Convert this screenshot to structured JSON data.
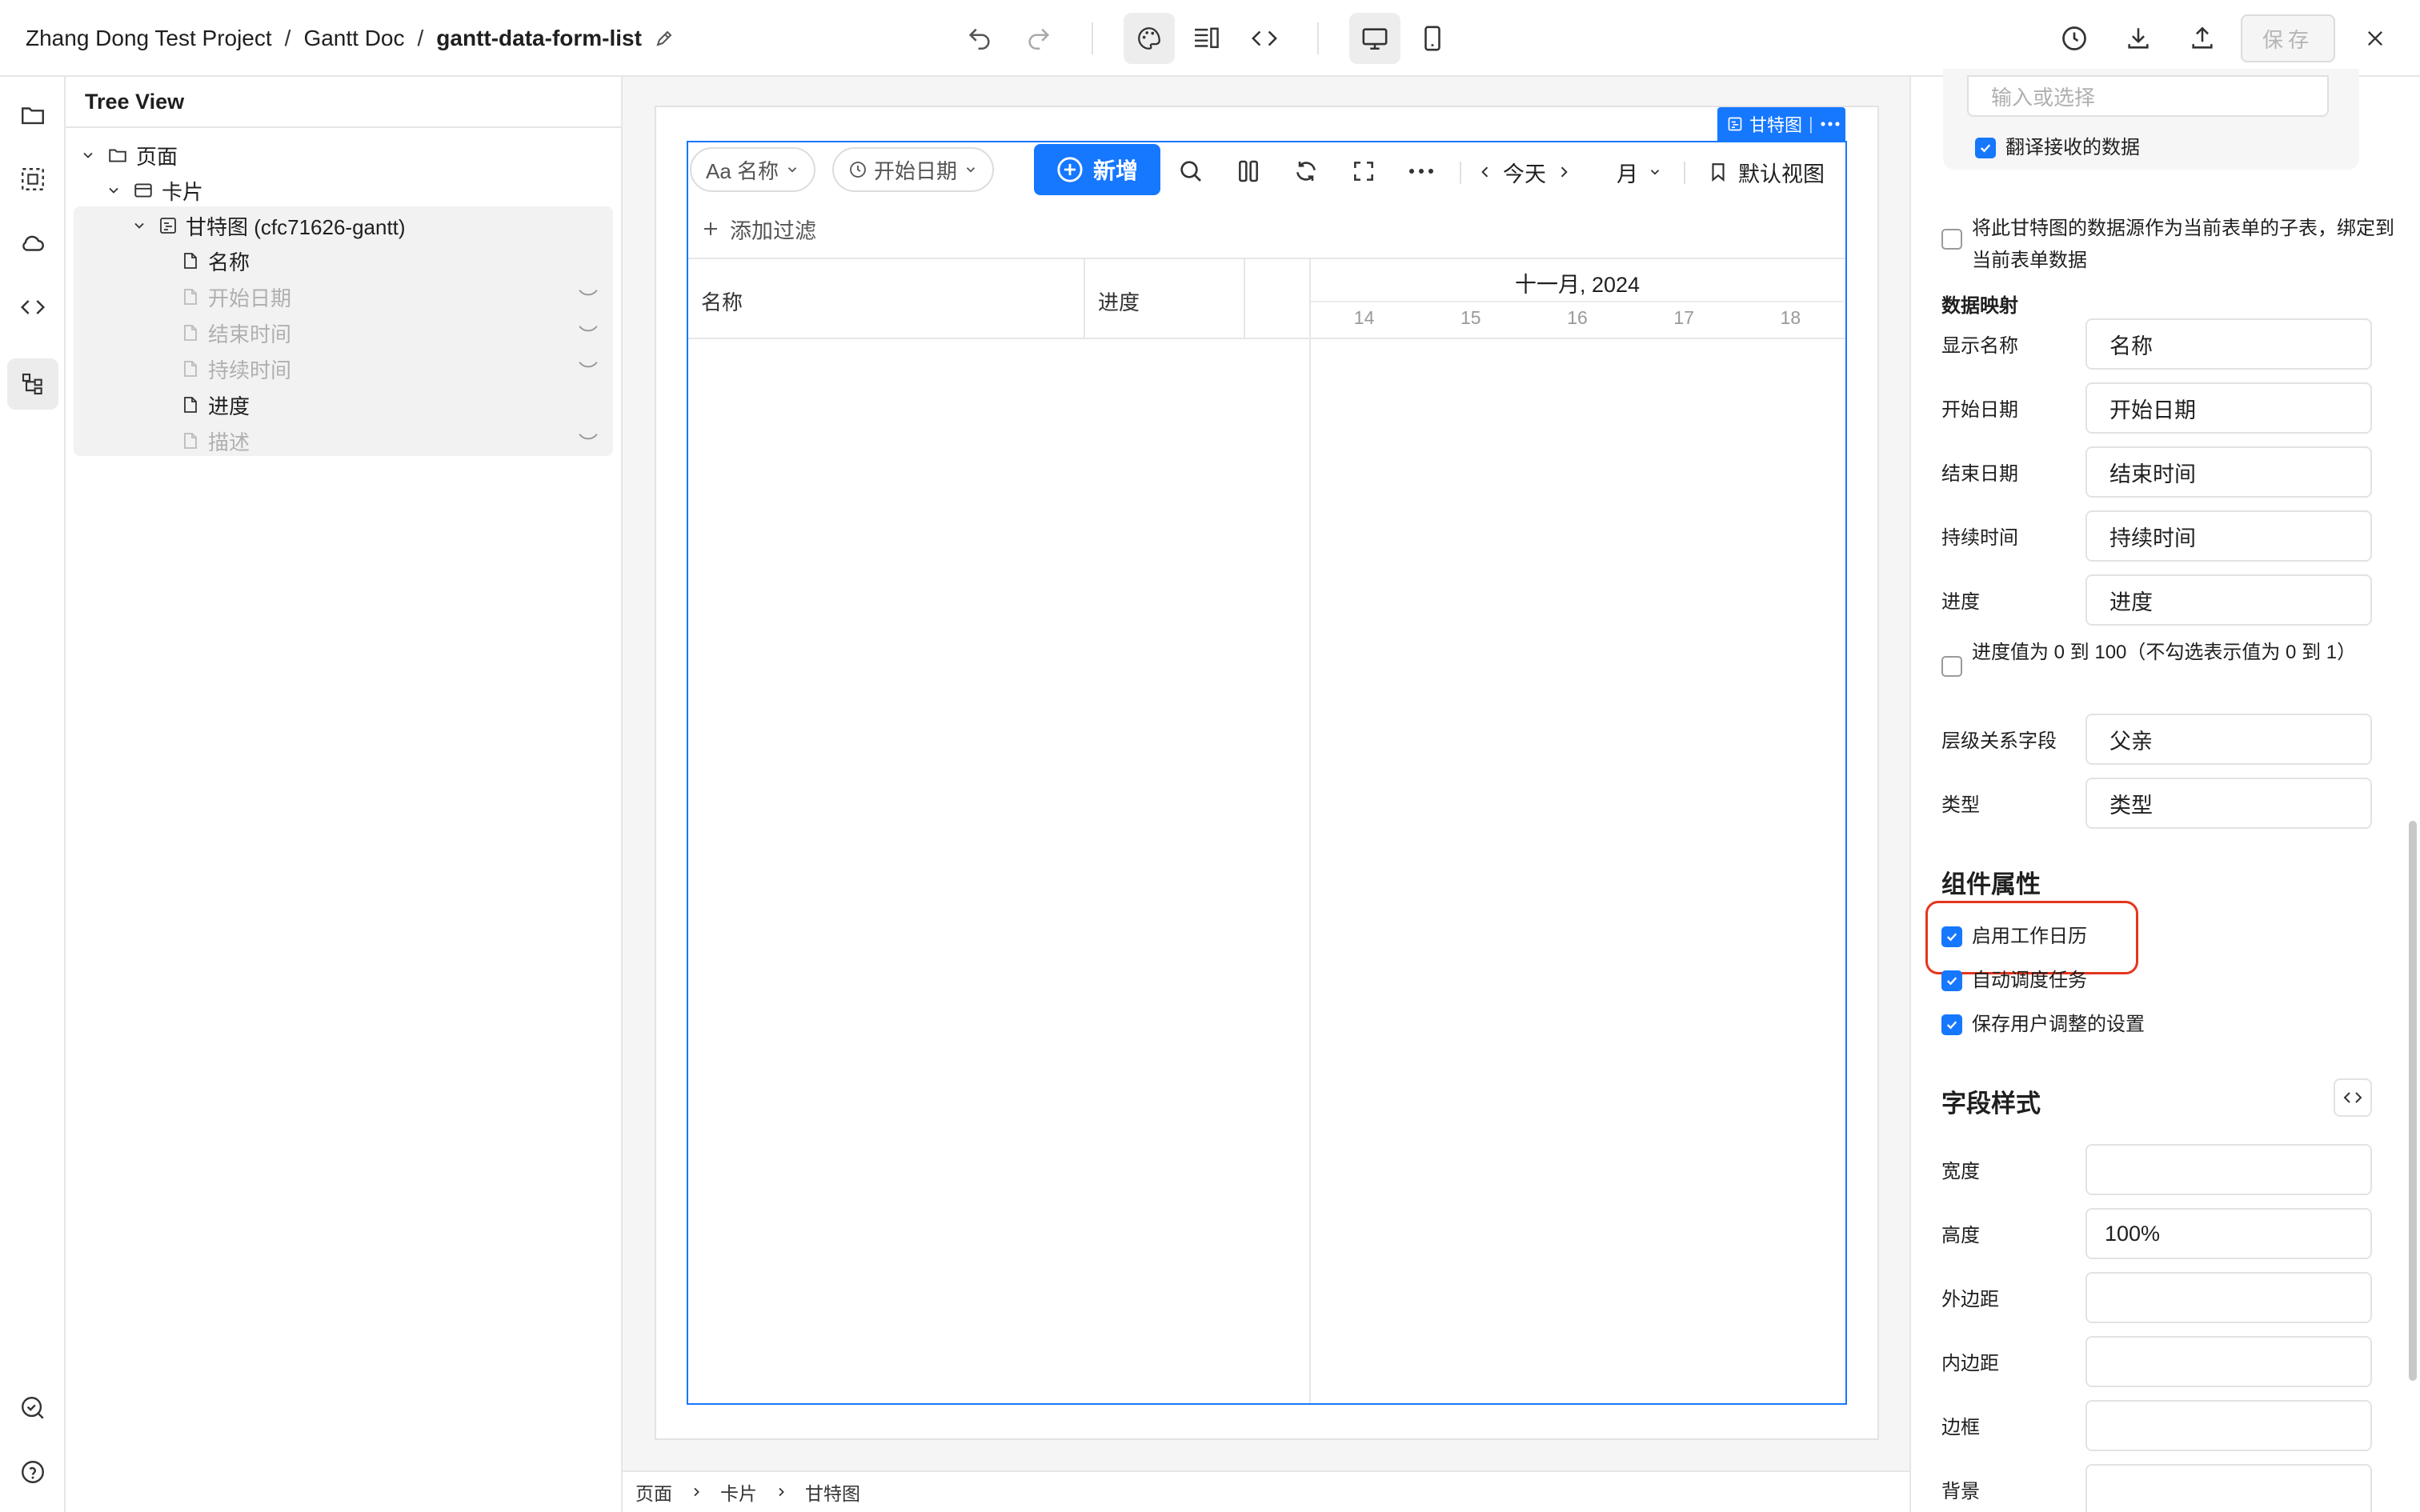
{
  "header": {
    "breadcrumb": [
      "Zhang Dong Test Project",
      "Gantt Doc",
      "gantt-data-form-list"
    ],
    "separator": "/",
    "save_label": "保存"
  },
  "icons": {
    "undo": "undo-icon",
    "redo": "redo-icon",
    "theme": "palette-icon",
    "layout": "layout-icon",
    "code": "code-icon",
    "desktop": "desktop-icon",
    "mobile": "mobile-icon",
    "history": "history-icon",
    "download": "download-icon",
    "upload": "upload-icon",
    "close": "close-icon"
  },
  "rail": [
    "folder-icon",
    "selection-icon",
    "cloud-icon",
    "code-icon",
    "tree-icon",
    "search-check-icon",
    "help-icon"
  ],
  "tree": {
    "title": "Tree View",
    "nodes": [
      {
        "label": "页面",
        "depth": 0,
        "kind": "folder",
        "dim": false
      },
      {
        "label": "卡片",
        "depth": 1,
        "kind": "card",
        "dim": false
      },
      {
        "label": "甘特图 (cfc71626-gantt)",
        "depth": 2,
        "kind": "gantt",
        "dim": false
      },
      {
        "label": "名称",
        "depth": 3,
        "kind": "file",
        "dim": false
      },
      {
        "label": "开始日期",
        "depth": 3,
        "kind": "file",
        "dim": true
      },
      {
        "label": "结束时间",
        "depth": 3,
        "kind": "file",
        "dim": true
      },
      {
        "label": "持续时间",
        "depth": 3,
        "kind": "file",
        "dim": true
      },
      {
        "label": "进度",
        "depth": 3,
        "kind": "file",
        "dim": false
      },
      {
        "label": "描述",
        "depth": 3,
        "kind": "file",
        "dim": true
      }
    ]
  },
  "gantt": {
    "tag_label": "甘特图",
    "pill_name": "Aa 名称",
    "pill_date": "开始日期",
    "add_label": "新增",
    "today": "今天",
    "scale": "月",
    "view": "默认视图",
    "add_filter": "添加过滤",
    "col_name": "名称",
    "col_progress": "进度",
    "month": "十一月, 2024",
    "days": [
      "14",
      "15",
      "16",
      "17",
      "18"
    ]
  },
  "bottom_breadcrumb": [
    "页面",
    "卡片",
    "甘特图"
  ],
  "panel": {
    "input_placeholder": "输入或选择",
    "translate_label": "翻译接收的数据",
    "translate_checked": true,
    "subtable_label": "将此甘特图的数据源作为当前表单的子表，绑定到当前表单数据",
    "subtable_checked": false,
    "mapping_title": "数据映射",
    "mappings": [
      {
        "label": "显示名称",
        "value": "名称"
      },
      {
        "label": "开始日期",
        "value": "开始日期"
      },
      {
        "label": "结束日期",
        "value": "结束时间"
      },
      {
        "label": "持续时间",
        "value": "持续时间"
      },
      {
        "label": "进度",
        "value": "进度"
      }
    ],
    "progress_range_label": "进度值为 0 到 100（不勾选表示值为 0 到 1）",
    "progress_range_checked": false,
    "hierarchy": {
      "label": "层级关系字段",
      "value": "父亲"
    },
    "type": {
      "label": "类型",
      "value": "类型"
    },
    "props_title": "组件属性",
    "props": [
      {
        "label": "启用工作日历",
        "checked": true
      },
      {
        "label": "自动调度任务",
        "checked": true
      },
      {
        "label": "保存用户调整的设置",
        "checked": true
      }
    ],
    "style_title": "字段样式",
    "styles": [
      {
        "label": "宽度",
        "value": ""
      },
      {
        "label": "高度",
        "value": "100%"
      },
      {
        "label": "外边距",
        "value": ""
      },
      {
        "label": "内边距",
        "value": ""
      },
      {
        "label": "边框",
        "value": ""
      },
      {
        "label": "背景",
        "value": ""
      }
    ]
  },
  "colors": {
    "accent": "#1677ff",
    "highlight": "#e5351e",
    "border": "#e6e6e6"
  }
}
